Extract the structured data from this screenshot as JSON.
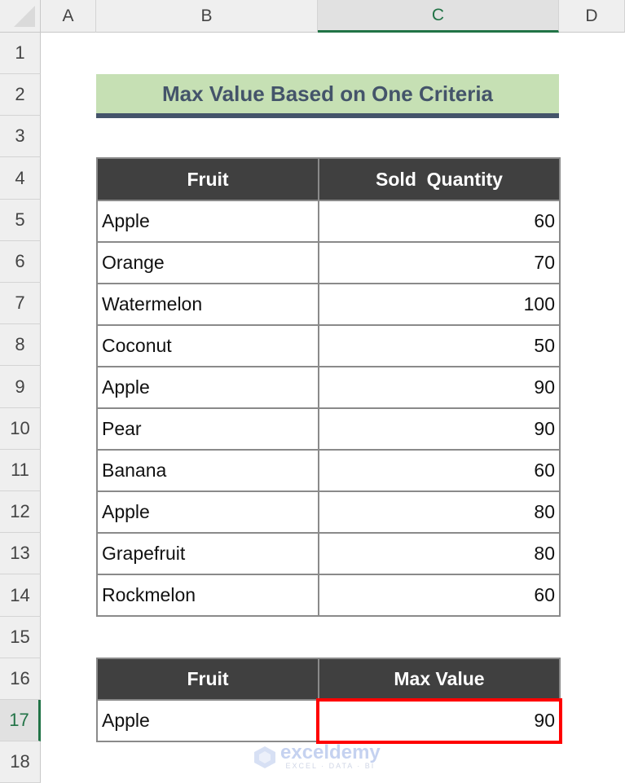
{
  "columns": [
    "A",
    "B",
    "C",
    "D"
  ],
  "selected_column": "C",
  "rows": [
    "1",
    "2",
    "3",
    "4",
    "5",
    "6",
    "7",
    "8",
    "9",
    "10",
    "11",
    "12",
    "13",
    "14",
    "15",
    "16",
    "17",
    "18"
  ],
  "selected_row": "17",
  "title": "Max Value Based on One Criteria",
  "main_table": {
    "headers": [
      "Fruit",
      "Sold  Quantity"
    ],
    "rows": [
      {
        "fruit": "Apple",
        "qty": "60"
      },
      {
        "fruit": "Orange",
        "qty": "70"
      },
      {
        "fruit": "Watermelon",
        "qty": "100"
      },
      {
        "fruit": "Coconut",
        "qty": "50"
      },
      {
        "fruit": "Apple",
        "qty": "90"
      },
      {
        "fruit": "Pear",
        "qty": "90"
      },
      {
        "fruit": "Banana",
        "qty": "60"
      },
      {
        "fruit": "Apple",
        "qty": "80"
      },
      {
        "fruit": "Grapefruit",
        "qty": "80"
      },
      {
        "fruit": "Rockmelon",
        "qty": "60"
      }
    ]
  },
  "result_table": {
    "headers": [
      "Fruit",
      "Max Value"
    ],
    "row": {
      "fruit": "Apple",
      "value": "90"
    }
  },
  "watermark": {
    "brand": "exceldemy",
    "tagline": "EXCEL · DATA · BI"
  },
  "colors": {
    "header_bg": "#404040",
    "title_bg": "#c6e0b4",
    "title_text": "#44546a",
    "highlight": "#ff0000",
    "selection": "#217346"
  }
}
